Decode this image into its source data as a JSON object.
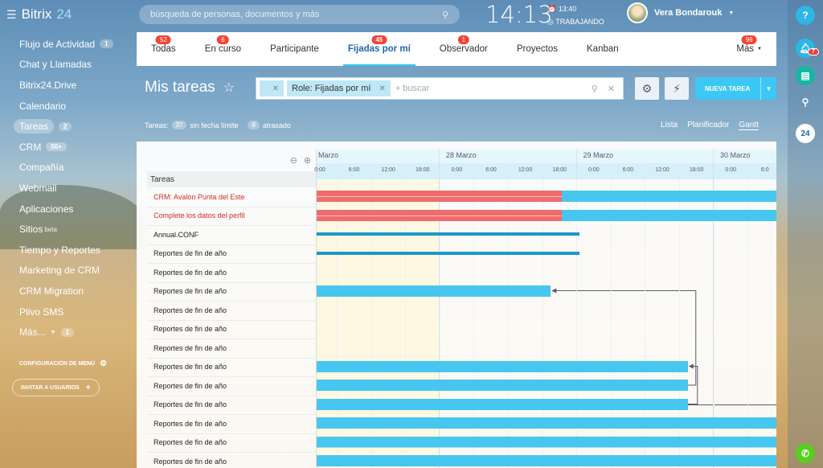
{
  "brand": {
    "name": "Bitrix",
    "num": "24"
  },
  "header": {
    "search_placeholder": "búsqueda de personas, documentos y más",
    "time": "14:13",
    "alarm_time": "13:40",
    "work_status": "TRABAJANDO",
    "user_name": "Vera Bondarouk"
  },
  "sidebar": {
    "items": [
      {
        "label": "Flujo de Actividad",
        "count": "1"
      },
      {
        "label": "Chat y Llamadas",
        "count": ""
      },
      {
        "label": "Bitrix24.Drive",
        "count": ""
      },
      {
        "label": "Calendario",
        "count": ""
      },
      {
        "label": "Tareas",
        "count": "2"
      },
      {
        "label": "CRM",
        "count": "50+"
      },
      {
        "label": "Compañía",
        "count": ""
      },
      {
        "label": "Webmail",
        "count": ""
      },
      {
        "label": "Aplicaciones",
        "count": ""
      },
      {
        "label": "Sitios",
        "count": "",
        "sup": "beta"
      },
      {
        "label": "Tiempo y Reportes",
        "count": ""
      },
      {
        "label": "Marketing de CRM",
        "count": ""
      },
      {
        "label": "CRM Migration",
        "count": ""
      },
      {
        "label": "Plivo SMS",
        "count": ""
      },
      {
        "label": "Más...",
        "count": "1"
      }
    ],
    "config": "CONFIGURACIÓN DE MENÚ",
    "invite": "INVITAR A USUARIOS"
  },
  "right_bar": {
    "help": "?",
    "notif_count": "7"
  },
  "tabs": [
    {
      "label": "Todas",
      "badge": "52"
    },
    {
      "label": "En curso",
      "badge": "6"
    },
    {
      "label": "Participante",
      "badge": ""
    },
    {
      "label": "Fijadas por mí",
      "badge": "45"
    },
    {
      "label": "Observador",
      "badge": "1"
    },
    {
      "label": "Proyectos",
      "badge": ""
    },
    {
      "label": "Kanban",
      "badge": ""
    },
    {
      "label": "Más",
      "badge": "99"
    }
  ],
  "page": {
    "title": "Mis tareas",
    "filter_chip": "Role: Fijadas por mí",
    "filter_placeholder": "+ buscar",
    "new_task": "NUEVA TAREA",
    "stats_label": "Tareas:",
    "no_deadline_count": "37",
    "no_deadline_label": "sin fecha límite",
    "overdue_count": "8",
    "overdue_label": "atrasado",
    "views": [
      "Lista",
      "Planificador",
      "Gantt"
    ]
  },
  "gantt": {
    "column_title": "Tareas",
    "days": [
      "Marzo",
      "28 Marzo",
      "29 Marzo",
      "30 Marzo"
    ],
    "hours": [
      "0:00",
      "6:00",
      "12:00",
      "18:00",
      "0:00",
      "6:00",
      "12:00",
      "18:00",
      "0:00",
      "6:00",
      "12:00",
      "18:00",
      "0:00",
      "6:0"
    ],
    "tasks": [
      {
        "name": "CRM: Avalon Punta del Este",
        "overdue": true
      },
      {
        "name": "Complete los datos del perfil",
        "overdue": true
      },
      {
        "name": "Annual.CONF",
        "overdue": false
      },
      {
        "name": "Reportes de fin de año",
        "overdue": false
      },
      {
        "name": "Reportes de fin de año",
        "overdue": false
      },
      {
        "name": "Reportes de fin de año",
        "overdue": false
      },
      {
        "name": "Reportes de fin de año",
        "overdue": false
      },
      {
        "name": "Reportes de fin de año",
        "overdue": false
      },
      {
        "name": "Reportes de fin de año",
        "overdue": false
      },
      {
        "name": "Reportes de fin de año",
        "overdue": false
      },
      {
        "name": "Reportes de fin de año",
        "overdue": false
      },
      {
        "name": "Reportes de fin de año",
        "overdue": false
      },
      {
        "name": "Reportes de fin de año",
        "overdue": false
      },
      {
        "name": "Reportes de fin de año",
        "overdue": false
      },
      {
        "name": "Reportes de fin de año",
        "overdue": false
      }
    ]
  }
}
